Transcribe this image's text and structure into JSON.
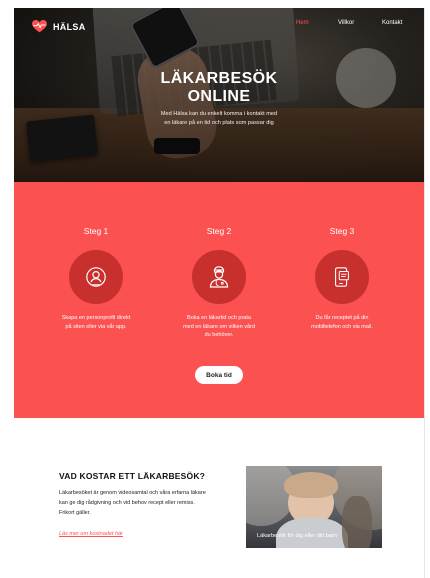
{
  "brand": {
    "name": "HÄLSA",
    "icon": "heart-pulse-icon",
    "accent_color": "#fb5150"
  },
  "nav": {
    "items": [
      {
        "label": "Hem",
        "active": true
      },
      {
        "label": "Villkor",
        "active": false
      },
      {
        "label": "Kontakt",
        "active": false
      }
    ]
  },
  "hero": {
    "title_line1": "LÄKARBESÖK",
    "title_line2": "ONLINE",
    "subtitle_line1": "Med Hälsa kan du enkelt komma i kontakt med",
    "subtitle_line2": "en läkare på en tid och plats som passar dig"
  },
  "steps": [
    {
      "title": "Steg 1",
      "icon": "user-profile-icon",
      "text_line1": "Skapa en personprofil direkt",
      "text_line2": "på siten eller via vår app.",
      "text_line3": ""
    },
    {
      "title": "Steg 2",
      "icon": "doctor-icon",
      "text_line1": "Boka en läkartid och prata",
      "text_line2": "med en läkare om vilken vård",
      "text_line3": "du behöver."
    },
    {
      "title": "Steg 3",
      "icon": "mobile-prescription-icon",
      "text_line1": "Du får receptet på din",
      "text_line2": "mobiltelefon och via mail.",
      "text_line3": ""
    }
  ],
  "book_button": {
    "label": "Boka tid"
  },
  "cost": {
    "title": "VAD KOSTAR ETT LÄKARBESÖK?",
    "text_line1": "Läkarbesöket är genom videosamtal och våra erfarna läkare",
    "text_line2": "kan ge dig rådgivning och vid behov recept eller remiss.",
    "text_line3": "Frikort gäller.",
    "link": "Läs mer om kostnadet här",
    "photo_caption": "Läkarbesök för dig eller ditt barn"
  }
}
